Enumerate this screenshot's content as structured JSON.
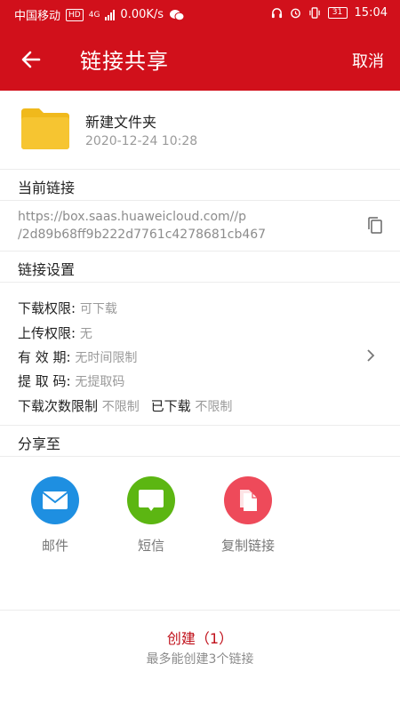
{
  "status_bar": {
    "carrier": "中国移动",
    "hd": "HD",
    "network": "4G",
    "speed": "0.00K/s",
    "battery": "31",
    "time": "15:04",
    "wechat_icon": "wechat-icon",
    "headset_icon": "headset-icon",
    "alarm_icon": "alarm-icon",
    "vibrate_icon": "vibrate-icon"
  },
  "header": {
    "back_icon": "back-arrow-icon",
    "title": "链接共享",
    "cancel": "取消"
  },
  "file": {
    "icon": "folder-icon",
    "name": "新建文件夹",
    "date": "2020-12-24 10:28"
  },
  "current_link": {
    "heading": "当前链接",
    "url_line1": "https://box.saas.huaweicloud.com//p",
    "url_line2": "/2d89b68ff9b222d7761c4278681cb467",
    "copy_icon": "copy-icon"
  },
  "link_settings": {
    "heading": "链接设置",
    "download_perm_label": "下载权限:",
    "download_perm_value": "可下载",
    "upload_perm_label": "上传权限:",
    "upload_perm_value": "无",
    "validity_label": "有 效 期:",
    "validity_value": "无时间限制",
    "code_label": "提 取 码:",
    "code_value": "无提取码",
    "download_limit_label": "下载次数限制",
    "download_limit_value": "不限制",
    "downloaded_label": "已下载",
    "downloaded_value": "不限制"
  },
  "share_to": {
    "heading": "分享至",
    "items": [
      {
        "label": "邮件",
        "icon": "mail-icon",
        "color": "#1e8fe1"
      },
      {
        "label": "短信",
        "icon": "sms-icon",
        "color": "#5cb612"
      },
      {
        "label": "复制链接",
        "icon": "copy-link-icon",
        "color": "#ee4a5a"
      }
    ]
  },
  "footer": {
    "create": "创建（1）",
    "limit_note": "最多能创建3个链接"
  },
  "colors": {
    "brand_red": "#d1101b",
    "folder_yellow": "#f6c531"
  }
}
